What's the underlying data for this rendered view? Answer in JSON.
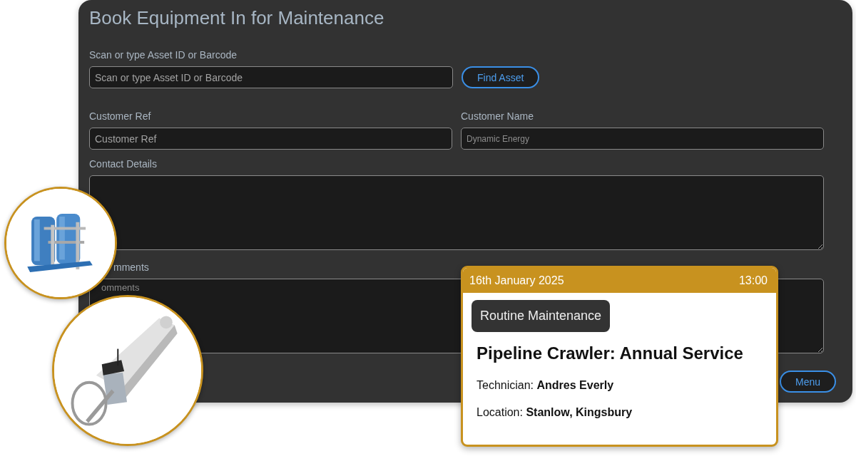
{
  "form": {
    "title": "Book Equipment In for Maintenance",
    "asset": {
      "label": "Scan or type Asset ID or Barcode",
      "placeholder": "Scan or type Asset ID or Barcode",
      "button": "Find Asset"
    },
    "customer_ref": {
      "label": "Customer Ref",
      "placeholder": "Customer Ref"
    },
    "customer_name": {
      "label": "Customer Name",
      "placeholder": "Dynamic Energy"
    },
    "contact_details": {
      "label": "Contact Details"
    },
    "comments": {
      "label": "mments",
      "placeholder": "omments"
    },
    "menu_button": "Menu"
  },
  "booking_card": {
    "date": "16th January 2025",
    "time": "13:00",
    "tag": "Routine Maintenance",
    "title": "Pipeline Crawler: Annual Service",
    "details": [
      "Technician: **Andres Everly**",
      "Location: **Stanlow, Kingsbury**"
    ]
  }
}
